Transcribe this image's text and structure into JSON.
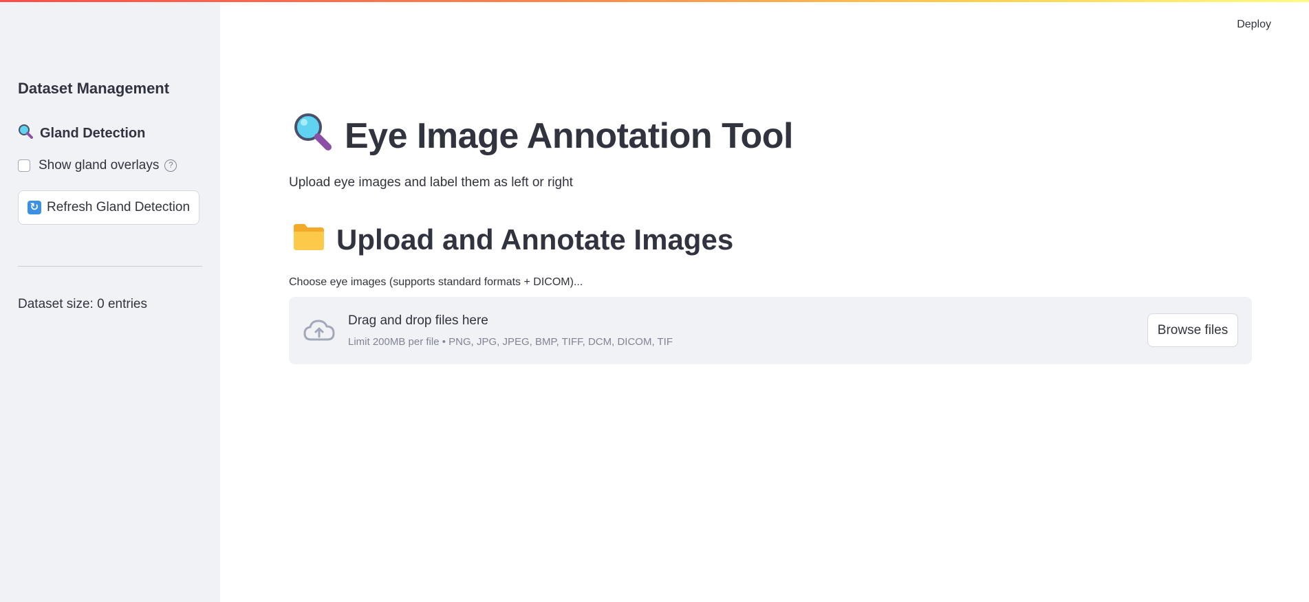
{
  "header": {
    "deploy_label": "Deploy"
  },
  "sidebar": {
    "title": "Dataset Management",
    "section_title": "Gland Detection",
    "checkbox_label": "Show gland overlays",
    "checkbox_checked": false,
    "help_glyph": "?",
    "refresh_button_label": "Refresh Gland Detection",
    "dataset_size": "Dataset size: 0 entries"
  },
  "main": {
    "title": "Eye Image Annotation Tool",
    "subtitle": "Upload eye images and label them as left or right",
    "section_title": "Upload and Annotate Images",
    "uploader": {
      "label": "Choose eye images (supports standard formats + DICOM)...",
      "drop_title": "Drag and drop files here",
      "limit_text": "Limit 200MB per file • PNG, JPG, JPEG, BMP, TIFF, DCM, DICOM, TIF",
      "browse_label": "Browse files"
    }
  },
  "icons": {
    "magnifier": "magnifying-glass-icon",
    "folder": "folder-icon",
    "refresh": "refresh-icon",
    "cloud": "cloud-upload-icon"
  }
}
